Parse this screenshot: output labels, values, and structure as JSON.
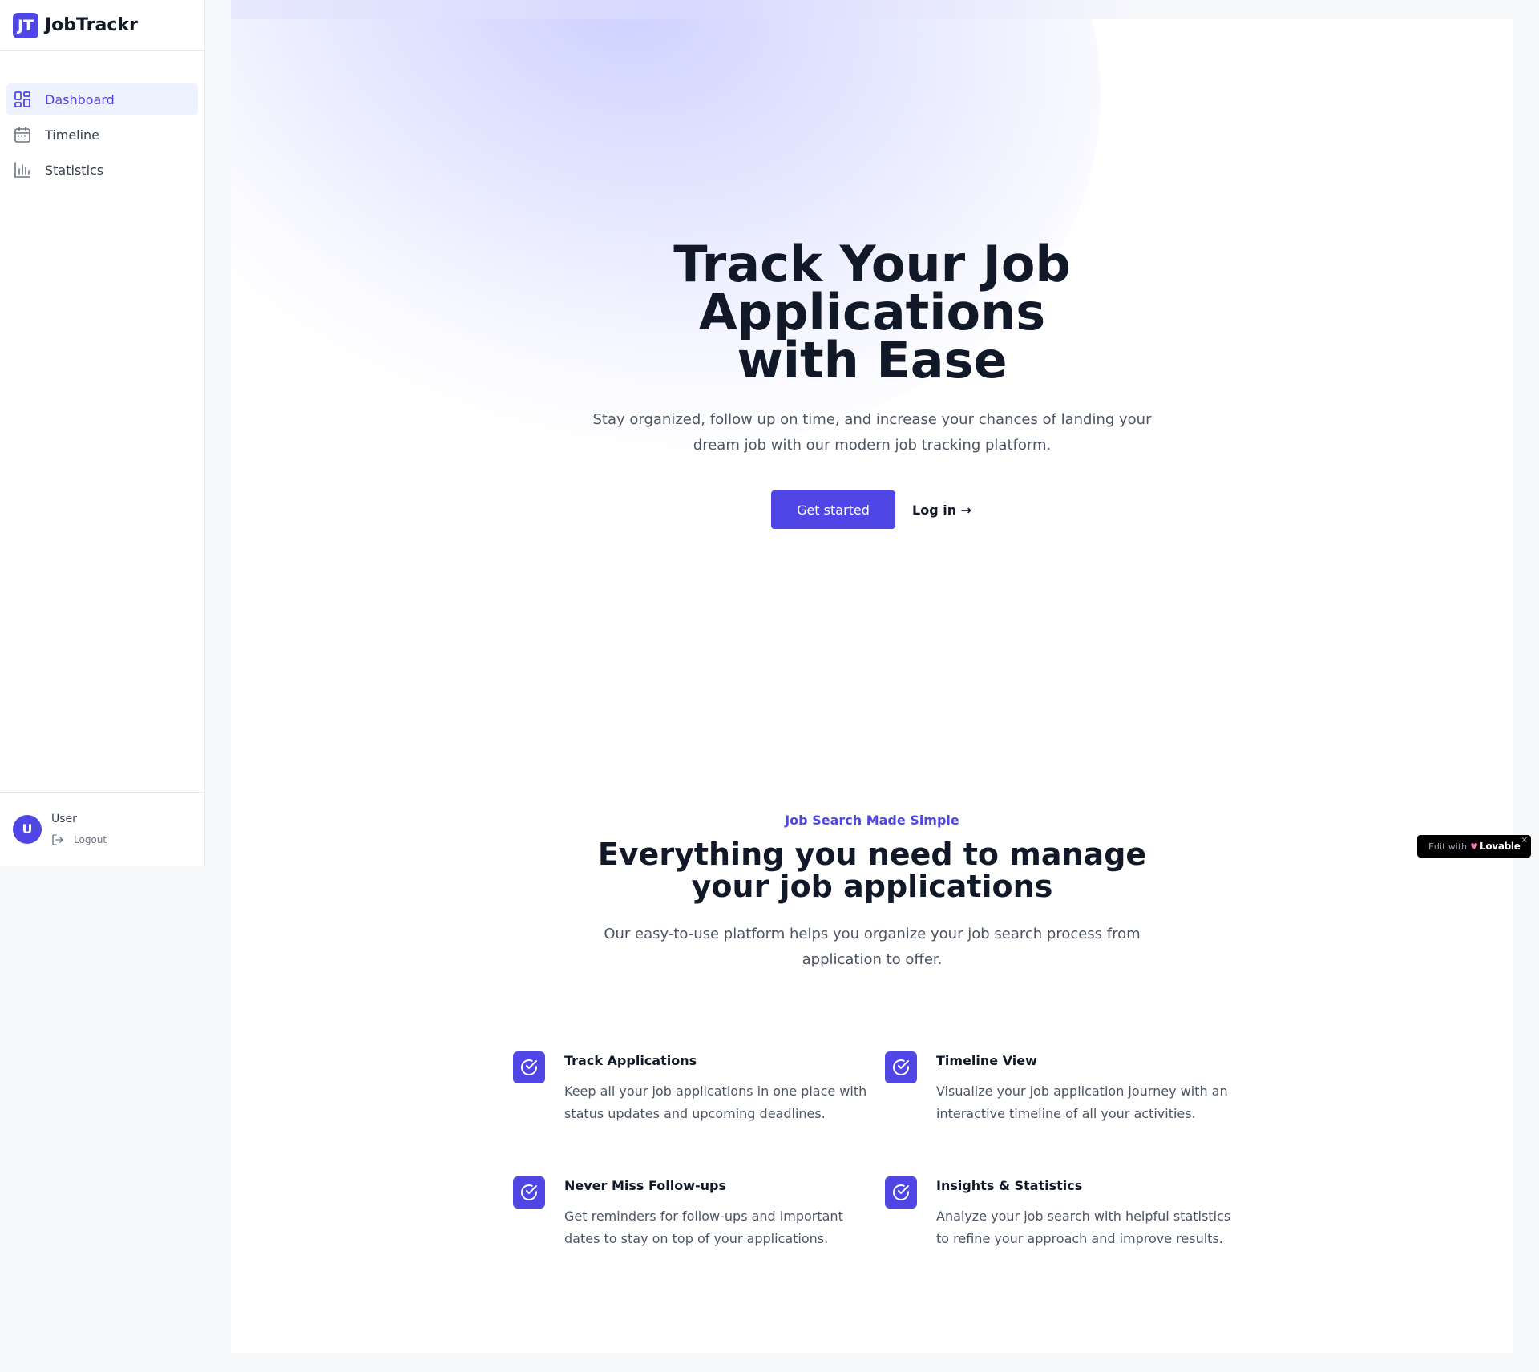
{
  "brand": {
    "logo_text": "JT",
    "name": "JobTrackr"
  },
  "sidebar": {
    "items": [
      {
        "label": "Dashboard",
        "icon": "dashboard-icon",
        "active": true
      },
      {
        "label": "Timeline",
        "icon": "calendar-icon",
        "active": false
      },
      {
        "label": "Statistics",
        "icon": "bar-chart-icon",
        "active": false
      }
    ],
    "user": {
      "initial": "U",
      "name": "User",
      "logout_label": "Logout"
    }
  },
  "hero": {
    "title": "Track Your Job Applications with Ease",
    "subtitle": "Stay organized, follow up on time, and increase your chances of landing your dream job with our modern job tracking platform.",
    "primary_button": "Get started",
    "secondary_link": "Log in →"
  },
  "features_section": {
    "eyebrow": "Job Search Made Simple",
    "title": "Everything you need to manage your job applications",
    "subtitle": "Our easy-to-use platform helps you organize your job search process from application to offer.",
    "items": [
      {
        "title": "Track Applications",
        "description": "Keep all your job applications in one place with status updates and upcoming deadlines.",
        "icon": "check-circle-icon"
      },
      {
        "title": "Timeline View",
        "description": "Visualize your job application journey with an interactive timeline of all your activities.",
        "icon": "check-circle-icon"
      },
      {
        "title": "Never Miss Follow-ups",
        "description": "Get reminders for follow-ups and important dates to stay on top of your applications.",
        "icon": "check-circle-icon"
      },
      {
        "title": "Insights & Statistics",
        "description": "Analyze your job search with helpful statistics to refine your approach and improve results.",
        "icon": "check-circle-icon"
      }
    ]
  },
  "badge": {
    "prefix": "Edit with",
    "brand": "Lovable",
    "close": "×"
  },
  "colors": {
    "accent": "#4f46e5",
    "accent_light": "#eef2ff",
    "text_dark": "#111827",
    "text_muted": "#4b5563"
  }
}
